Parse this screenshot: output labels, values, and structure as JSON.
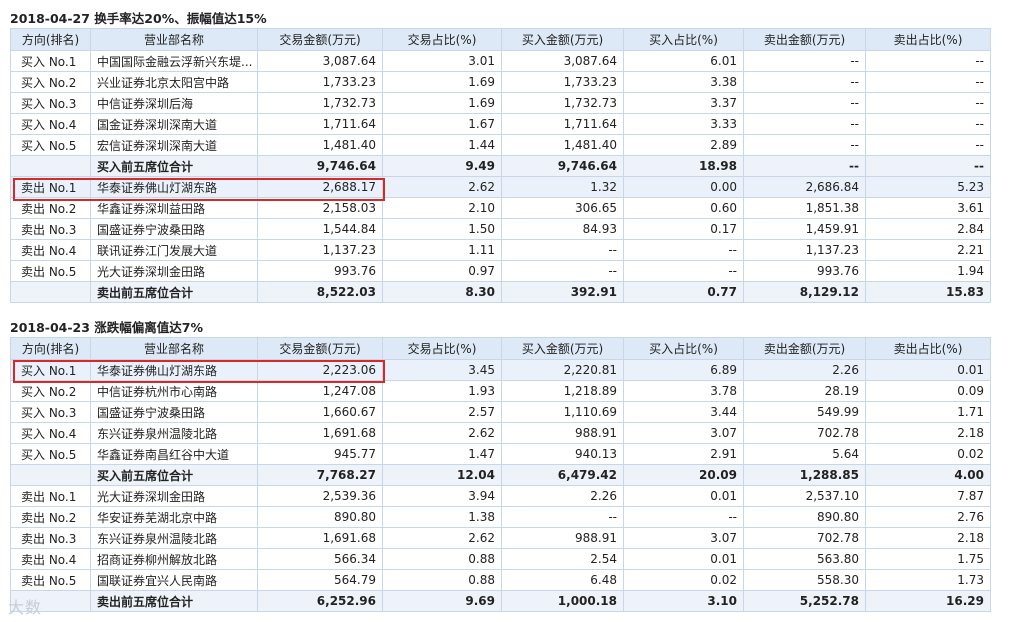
{
  "headers": [
    "方向(排名)",
    "营业部名称",
    "交易金额(万元)",
    "交易占比(%)",
    "买入金额(万元)",
    "买入占比(%)",
    "卖出金额(万元)",
    "卖出占比(%)"
  ],
  "sections": [
    {
      "title": "2018-04-27 换手率达20%、振幅值达15%",
      "rows": [
        {
          "dir": "买入 No.1",
          "name": "中国国际金融云浮新兴东堤...",
          "amt": "3,087.64",
          "pct": "3.01",
          "buy": "3,087.64",
          "buypct": "6.01",
          "sell": "--",
          "sellpct": "--"
        },
        {
          "dir": "买入 No.2",
          "name": "兴业证券北京太阳宫中路",
          "amt": "1,733.23",
          "pct": "1.69",
          "buy": "1,733.23",
          "buypct": "3.38",
          "sell": "--",
          "sellpct": "--"
        },
        {
          "dir": "买入 No.3",
          "name": "中信证券深圳后海",
          "amt": "1,732.73",
          "pct": "1.69",
          "buy": "1,732.73",
          "buypct": "3.37",
          "sell": "--",
          "sellpct": "--"
        },
        {
          "dir": "买入 No.4",
          "name": "国金证券深圳深南大道",
          "amt": "1,711.64",
          "pct": "1.67",
          "buy": "1,711.64",
          "buypct": "3.33",
          "sell": "--",
          "sellpct": "--"
        },
        {
          "dir": "买入 No.5",
          "name": "宏信证券深圳深南大道",
          "amt": "1,481.40",
          "pct": "1.44",
          "buy": "1,481.40",
          "buypct": "2.89",
          "sell": "--",
          "sellpct": "--"
        },
        {
          "dir": "",
          "name": "买入前五席位合计",
          "amt": "9,746.64",
          "pct": "9.49",
          "buy": "9,746.64",
          "buypct": "18.98",
          "sell": "--",
          "sellpct": "--",
          "total": true
        },
        {
          "dir": "卖出 No.1",
          "name": "华泰证券佛山灯湖东路",
          "amt": "2,688.17",
          "pct": "2.62",
          "buy": "1.32",
          "buypct": "0.00",
          "sell": "2,686.84",
          "sellpct": "5.23",
          "hl": true
        },
        {
          "dir": "卖出 No.2",
          "name": "华鑫证券深圳益田路",
          "amt": "2,158.03",
          "pct": "2.10",
          "buy": "306.65",
          "buypct": "0.60",
          "sell": "1,851.38",
          "sellpct": "3.61"
        },
        {
          "dir": "卖出 No.3",
          "name": "国盛证券宁波桑田路",
          "amt": "1,544.84",
          "pct": "1.50",
          "buy": "84.93",
          "buypct": "0.17",
          "sell": "1,459.91",
          "sellpct": "2.84"
        },
        {
          "dir": "卖出 No.4",
          "name": "联讯证券江门发展大道",
          "amt": "1,137.23",
          "pct": "1.11",
          "buy": "--",
          "buypct": "--",
          "sell": "1,137.23",
          "sellpct": "2.21"
        },
        {
          "dir": "卖出 No.5",
          "name": "光大证券深圳金田路",
          "amt": "993.76",
          "pct": "0.97",
          "buy": "--",
          "buypct": "--",
          "sell": "993.76",
          "sellpct": "1.94"
        },
        {
          "dir": "",
          "name": "卖出前五席位合计",
          "amt": "8,522.03",
          "pct": "8.30",
          "buy": "392.91",
          "buypct": "0.77",
          "sell": "8,129.12",
          "sellpct": "15.83",
          "total": true
        }
      ]
    },
    {
      "title": "2018-04-23 涨跌幅偏离值达7%",
      "rows": [
        {
          "dir": "买入 No.1",
          "name": "华泰证券佛山灯湖东路",
          "amt": "2,223.06",
          "pct": "3.45",
          "buy": "2,220.81",
          "buypct": "6.89",
          "sell": "2.26",
          "sellpct": "0.01",
          "hl": true
        },
        {
          "dir": "买入 No.2",
          "name": "中信证券杭州市心南路",
          "amt": "1,247.08",
          "pct": "1.93",
          "buy": "1,218.89",
          "buypct": "3.78",
          "sell": "28.19",
          "sellpct": "0.09"
        },
        {
          "dir": "买入 No.3",
          "name": "国盛证券宁波桑田路",
          "amt": "1,660.67",
          "pct": "2.57",
          "buy": "1,110.69",
          "buypct": "3.44",
          "sell": "549.99",
          "sellpct": "1.71"
        },
        {
          "dir": "买入 No.4",
          "name": "东兴证券泉州温陵北路",
          "amt": "1,691.68",
          "pct": "2.62",
          "buy": "988.91",
          "buypct": "3.07",
          "sell": "702.78",
          "sellpct": "2.18"
        },
        {
          "dir": "买入 No.5",
          "name": "华鑫证券南昌红谷中大道",
          "amt": "945.77",
          "pct": "1.47",
          "buy": "940.13",
          "buypct": "2.91",
          "sell": "5.64",
          "sellpct": "0.02"
        },
        {
          "dir": "",
          "name": "买入前五席位合计",
          "amt": "7,768.27",
          "pct": "12.04",
          "buy": "6,479.42",
          "buypct": "20.09",
          "sell": "1,288.85",
          "sellpct": "4.00",
          "total": true
        },
        {
          "dir": "卖出 No.1",
          "name": "光大证券深圳金田路",
          "amt": "2,539.36",
          "pct": "3.94",
          "buy": "2.26",
          "buypct": "0.01",
          "sell": "2,537.10",
          "sellpct": "7.87"
        },
        {
          "dir": "卖出 No.2",
          "name": "华安证券芜湖北京中路",
          "amt": "890.80",
          "pct": "1.38",
          "buy": "--",
          "buypct": "--",
          "sell": "890.80",
          "sellpct": "2.76"
        },
        {
          "dir": "卖出 No.3",
          "name": "东兴证券泉州温陵北路",
          "amt": "1,691.68",
          "pct": "2.62",
          "buy": "988.91",
          "buypct": "3.07",
          "sell": "702.78",
          "sellpct": "2.18"
        },
        {
          "dir": "卖出 No.4",
          "name": "招商证券柳州解放北路",
          "amt": "566.34",
          "pct": "0.88",
          "buy": "2.54",
          "buypct": "0.01",
          "sell": "563.80",
          "sellpct": "1.75"
        },
        {
          "dir": "卖出 No.5",
          "name": "国联证券宜兴人民南路",
          "amt": "564.79",
          "pct": "0.88",
          "buy": "6.48",
          "buypct": "0.02",
          "sell": "558.30",
          "sellpct": "1.73"
        },
        {
          "dir": "",
          "name": "卖出前五席位合计",
          "amt": "6,252.96",
          "pct": "9.69",
          "buy": "1,000.18",
          "buypct": "3.10",
          "sell": "5,252.78",
          "sellpct": "16.29",
          "total": true
        }
      ]
    }
  ],
  "watermark": "大数"
}
